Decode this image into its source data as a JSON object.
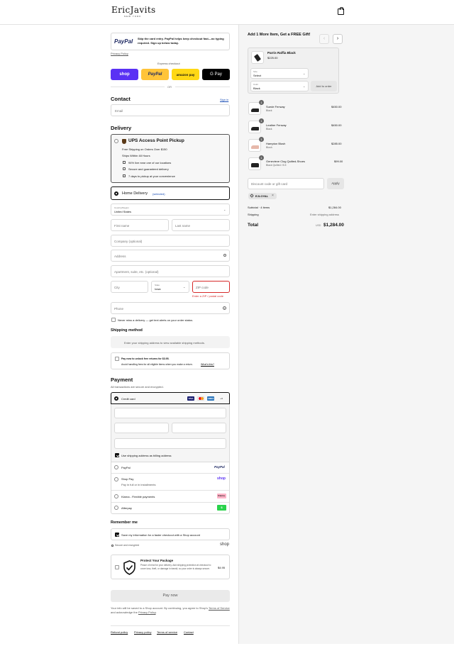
{
  "header": {
    "logo": "EricJavits",
    "logo_sub": "NEW YORK",
    "cart_icon": "shopping-bag-icon"
  },
  "paypal_banner": {
    "logo": "PayPal",
    "text": "Skip the card entry. PayPal helps keep checkout fast—no typing required. Sign up below today.",
    "policy": "Privacy Policy"
  },
  "express": {
    "title": "Express checkout",
    "buttons": [
      "shop",
      "PayPal",
      "amazon pay",
      "G Pay"
    ],
    "or": "OR"
  },
  "contact": {
    "title": "Contact",
    "signin": "Sign in",
    "email_placeholder": "Email"
  },
  "delivery": {
    "title": "Delivery",
    "ups": {
      "title": "UPS Access Point Pickup",
      "line1": "Free Shipping on Orders Over $150",
      "line2": "Ships Within 48 Hours",
      "bullets": [
        "94% live near one of our locations",
        "Secure and guaranteed delivery",
        "7 days to pickup at your convenience"
      ]
    },
    "home": {
      "label": "Home Delivery",
      "selected": "(selected)"
    },
    "country_label": "Country/Region",
    "country": "United States",
    "first_name": "First name",
    "last_name": "Last name",
    "company": "Company (optional)",
    "address": "Address",
    "apartment": "Apartment, suite, etc. (optional)",
    "city": "City",
    "state_label": "State",
    "state": "Iowa",
    "zip": "ZIP code",
    "zip_error": "Enter a ZIP / postal code",
    "phone": "Phone",
    "sms": "Never miss a delivery — get text alerts on your order status."
  },
  "shipping_method": {
    "title": "Shipping method",
    "notice": "Enter your shipping address to view available shipping methods.",
    "returns_title": "Pay now to unlock free returns for $3.95.",
    "returns_text": "Avoid handling fees for all eligible items when you make a return.",
    "returns_link": "What's this?"
  },
  "payment": {
    "title": "Payment",
    "subtitle": "All transactions are secure and encrypted.",
    "credit_card": "Credit card",
    "cards": [
      "VISA",
      "MC",
      "AMEX",
      "+4"
    ],
    "billing_same": "Use shipping address as billing address",
    "options": [
      {
        "label": "PayPal",
        "sub": "",
        "badge": "PayPal"
      },
      {
        "label": "Shop Pay",
        "sub": "Pay in full or in installments",
        "badge": "shop"
      },
      {
        "label": "Klarna - Flexible payments",
        "sub": "",
        "badge": "Klarna."
      },
      {
        "label": "Afterpay",
        "sub": "",
        "badge": "$"
      }
    ]
  },
  "remember": {
    "title": "Remember me",
    "save_info": "Save my information for a faster checkout with a Shop account",
    "secure": "Secure and encrypted",
    "shop": "shop"
  },
  "protect": {
    "title": "Protect Your Package",
    "text": "Peace of mind for your delivery. Add shipping protection at checkout to cover loss, theft, or damage in transit, so your order is always secure.",
    "price": "$4.95"
  },
  "pay_now": "Pay now",
  "legal": {
    "pre": "Your info will be saved to a Shop account. By continuing, you agree to Shop's",
    "terms": "Terms of Service",
    "mid": "and acknowledge the",
    "privacy": "Privacy Policy",
    "end": "."
  },
  "footer_links": [
    "Refund policy",
    "Privacy policy",
    "Terms of service",
    "Contact"
  ],
  "upsell": {
    "title": "Add 1 More Item, Get a FREE Gift!",
    "product": "Parris Raffia Black",
    "price": "$225.00",
    "size_label": "Size",
    "size": "Select",
    "color_label": "Color",
    "color": "Black",
    "add_btn": "Add to order"
  },
  "cart": [
    {
      "qty": "1",
      "name": "Suede Fenway",
      "variant": "Black",
      "price": "$450.00"
    },
    {
      "qty": "1",
      "name": "Leather Fenway",
      "variant": "Black",
      "price": "$450.00"
    },
    {
      "qty": "1",
      "name": "Hampton Blush",
      "variant": "Blush",
      "price": "$285.00"
    },
    {
      "qty": "1",
      "name": "Genevieve Clog Quilted-Shoes",
      "variant": "Black Quilted / 8.5",
      "price": "$99.00"
    }
  ],
  "discount": {
    "placeholder": "Discount code or gift card",
    "apply": "Apply",
    "tag": "EJLOYAL"
  },
  "summary": {
    "subtotal_label": "Subtotal · 4 items",
    "subtotal": "$1,284.00",
    "shipping_label": "Shipping",
    "shipping": "Enter shipping address",
    "total_label": "Total",
    "currency": "USD",
    "total": "$1,284.00"
  }
}
